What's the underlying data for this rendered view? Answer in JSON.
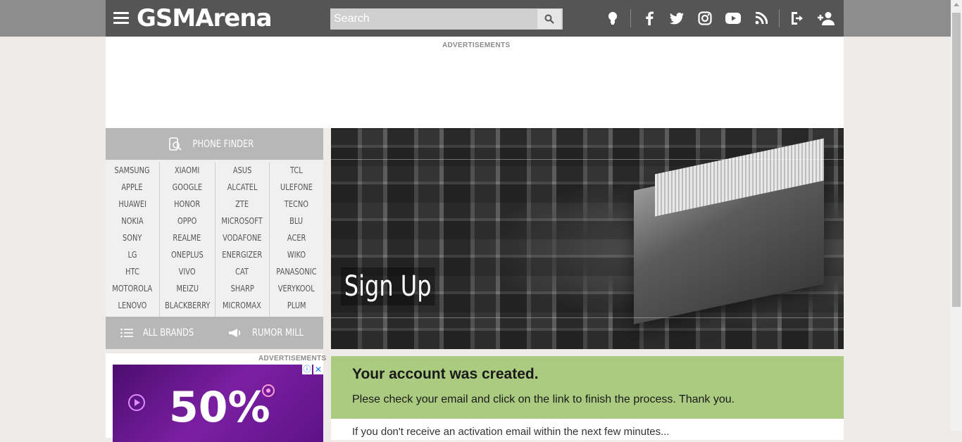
{
  "header": {
    "logo_text": "GSMArena",
    "search": {
      "placeholder": "Search"
    },
    "icons": [
      "menu-icon",
      "tip-bulb-icon",
      "facebook-icon",
      "twitter-icon",
      "instagram-icon",
      "youtube-icon",
      "rss-icon",
      "login-icon",
      "add-user-icon"
    ]
  },
  "ads": {
    "top_label": "ADVERTISEMENTS",
    "side_label": "ADVERTISEMENTS",
    "side_promo_text": "50%"
  },
  "sidebar": {
    "phone_finder_label": "PHONE FINDER",
    "brand_columns": [
      [
        "SAMSUNG",
        "APPLE",
        "HUAWEI",
        "NOKIA",
        "SONY",
        "LG",
        "HTC",
        "MOTOROLA",
        "LENOVO"
      ],
      [
        "XIAOMI",
        "GOOGLE",
        "HONOR",
        "OPPO",
        "REALME",
        "ONEPLUS",
        "VIVO",
        "MEIZU",
        "BLACKBERRY"
      ],
      [
        "ASUS",
        "ALCATEL",
        "ZTE",
        "MICROSOFT",
        "VODAFONE",
        "ENERGIZER",
        "CAT",
        "SHARP",
        "MICROMAX"
      ],
      [
        "TCL",
        "ULEFONE",
        "TECNO",
        "BLU",
        "ACER",
        "WIKO",
        "PANASONIC",
        "VERYKOOL",
        "PLUM"
      ]
    ],
    "all_brands_label": "ALL BRANDS",
    "rumor_mill_label": "RUMOR MILL"
  },
  "main": {
    "hero_title": "Sign Up",
    "notice_title": "Your account was created.",
    "notice_text": "Plese check your email and click on the link to finish the process. Thank you.",
    "below_text": "If you don't receive an activation email within the next few minutes..."
  },
  "colors": {
    "header_bg": "#555555",
    "sidebar_header_bg": "#b7b7b7",
    "notice_bg": "#aacb80",
    "page_bg": "#efebe9"
  }
}
